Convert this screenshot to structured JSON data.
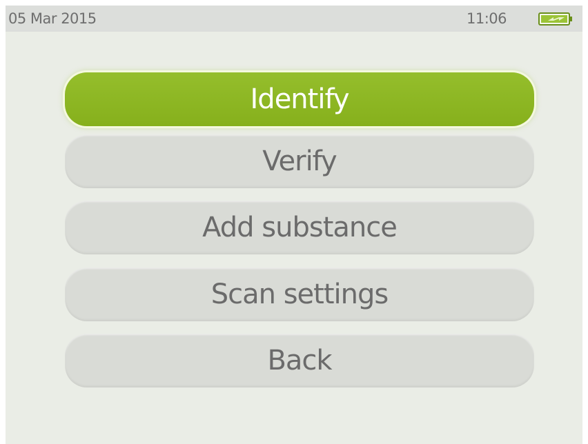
{
  "status_bar": {
    "date": "05 Mar 2015",
    "time": "11:06",
    "battery_icon": "battery-charging-icon"
  },
  "menu": {
    "selected_index": 0,
    "items": [
      {
        "label": "Identify"
      },
      {
        "label": "Verify"
      },
      {
        "label": "Add substance"
      },
      {
        "label": "Scan settings"
      },
      {
        "label": "Back"
      }
    ]
  },
  "colors": {
    "accent": "#8cb523",
    "screen_background": "#eaede6",
    "status_bar_background": "#dcdedb",
    "button_background": "#d9dbd6",
    "button_text": "#6b6b6b"
  }
}
